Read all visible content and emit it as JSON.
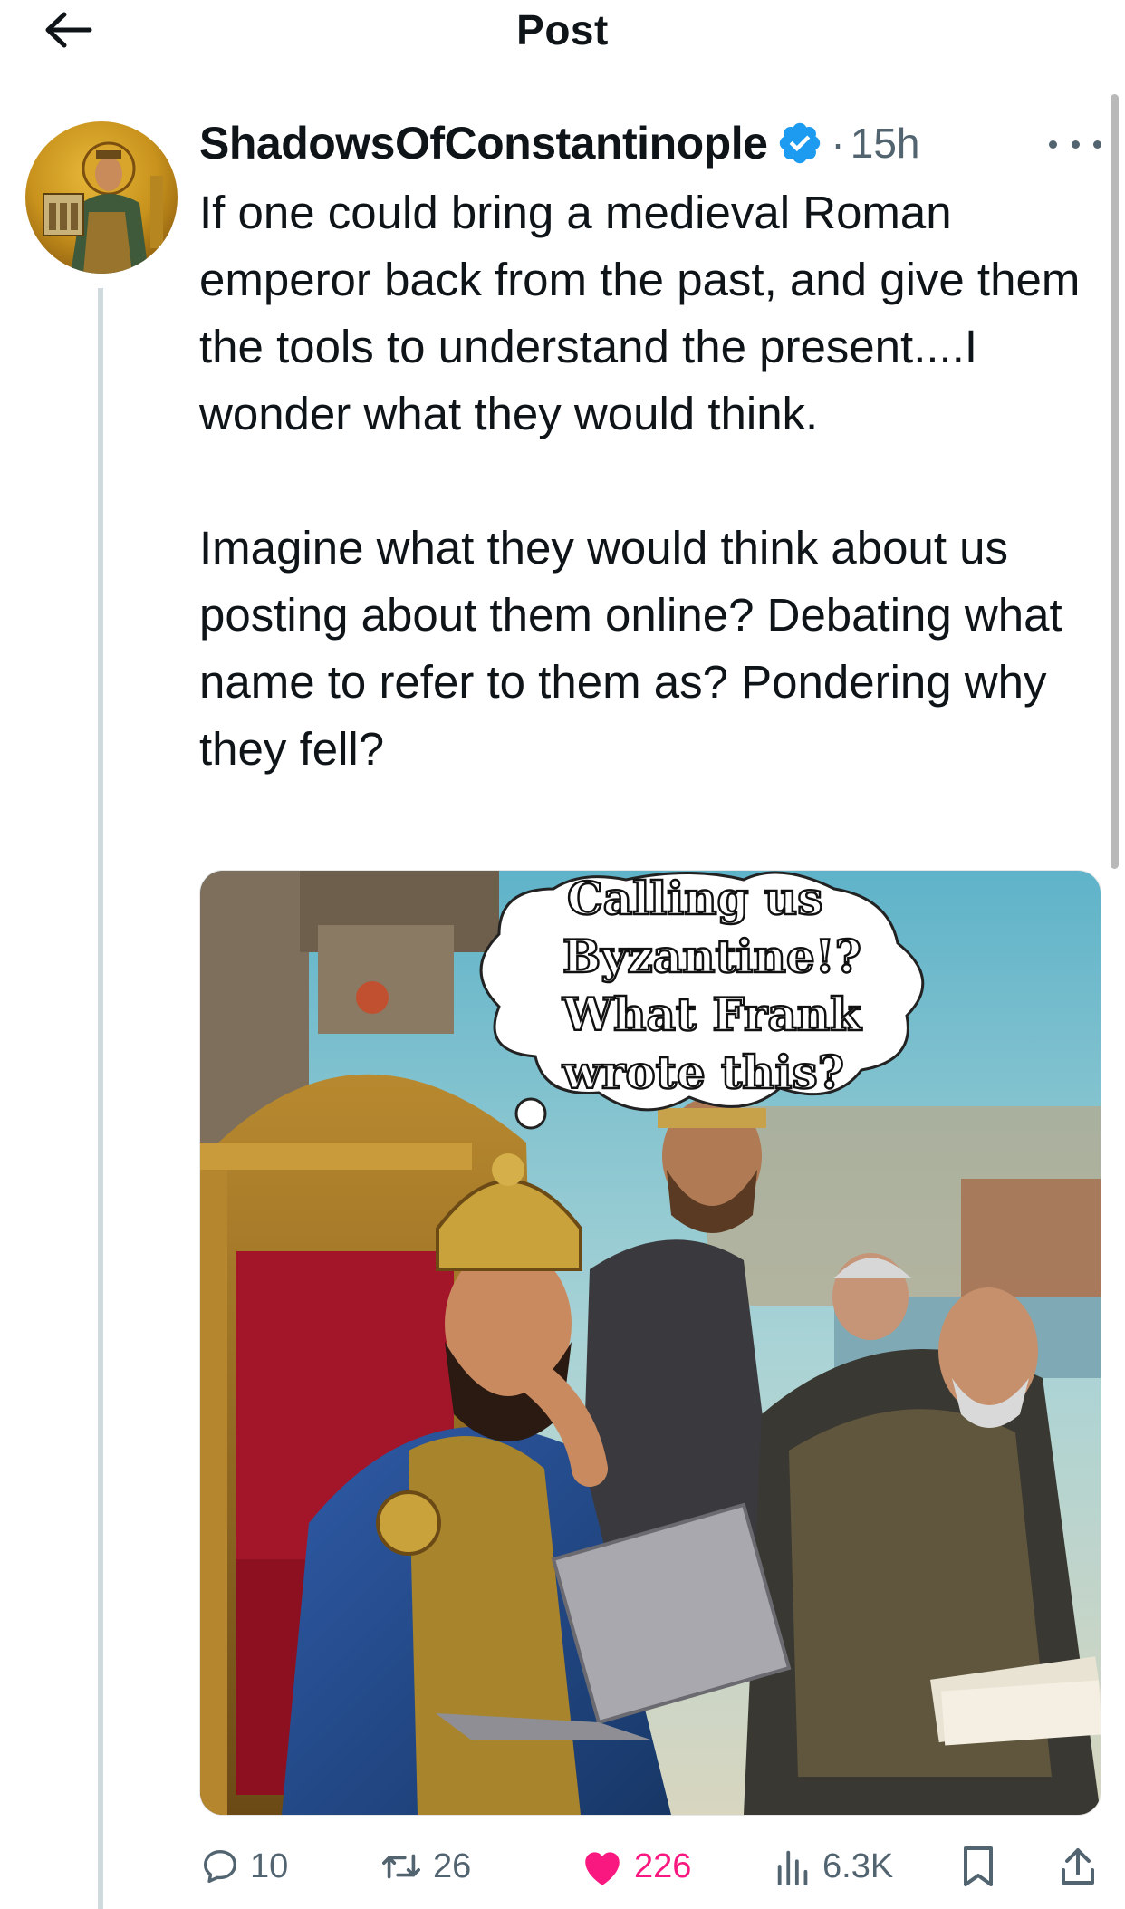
{
  "header": {
    "title": "Post",
    "back_icon": "arrow-left-icon"
  },
  "post": {
    "author": "ShadowsOfConstantinople",
    "verified": true,
    "separator": "·",
    "time": "15h",
    "text": "If one could bring a medieval Roman emperor back from the past, and give them the tools to understand the present....I wonder what they would think.\n\nImagine what they would think about us posting about them online? Debating what name to refer to them as? Pondering why they fell?",
    "image": {
      "speech_lines": [
        "Calling us",
        "Byzantine!?",
        "What Frank",
        "wrote this?"
      ]
    }
  },
  "actions": {
    "replies": "10",
    "reposts": "26",
    "likes": "226",
    "views": "6.3K"
  },
  "colors": {
    "verified": "#1d9bf0",
    "like": "#f91880",
    "muted": "#536471"
  }
}
